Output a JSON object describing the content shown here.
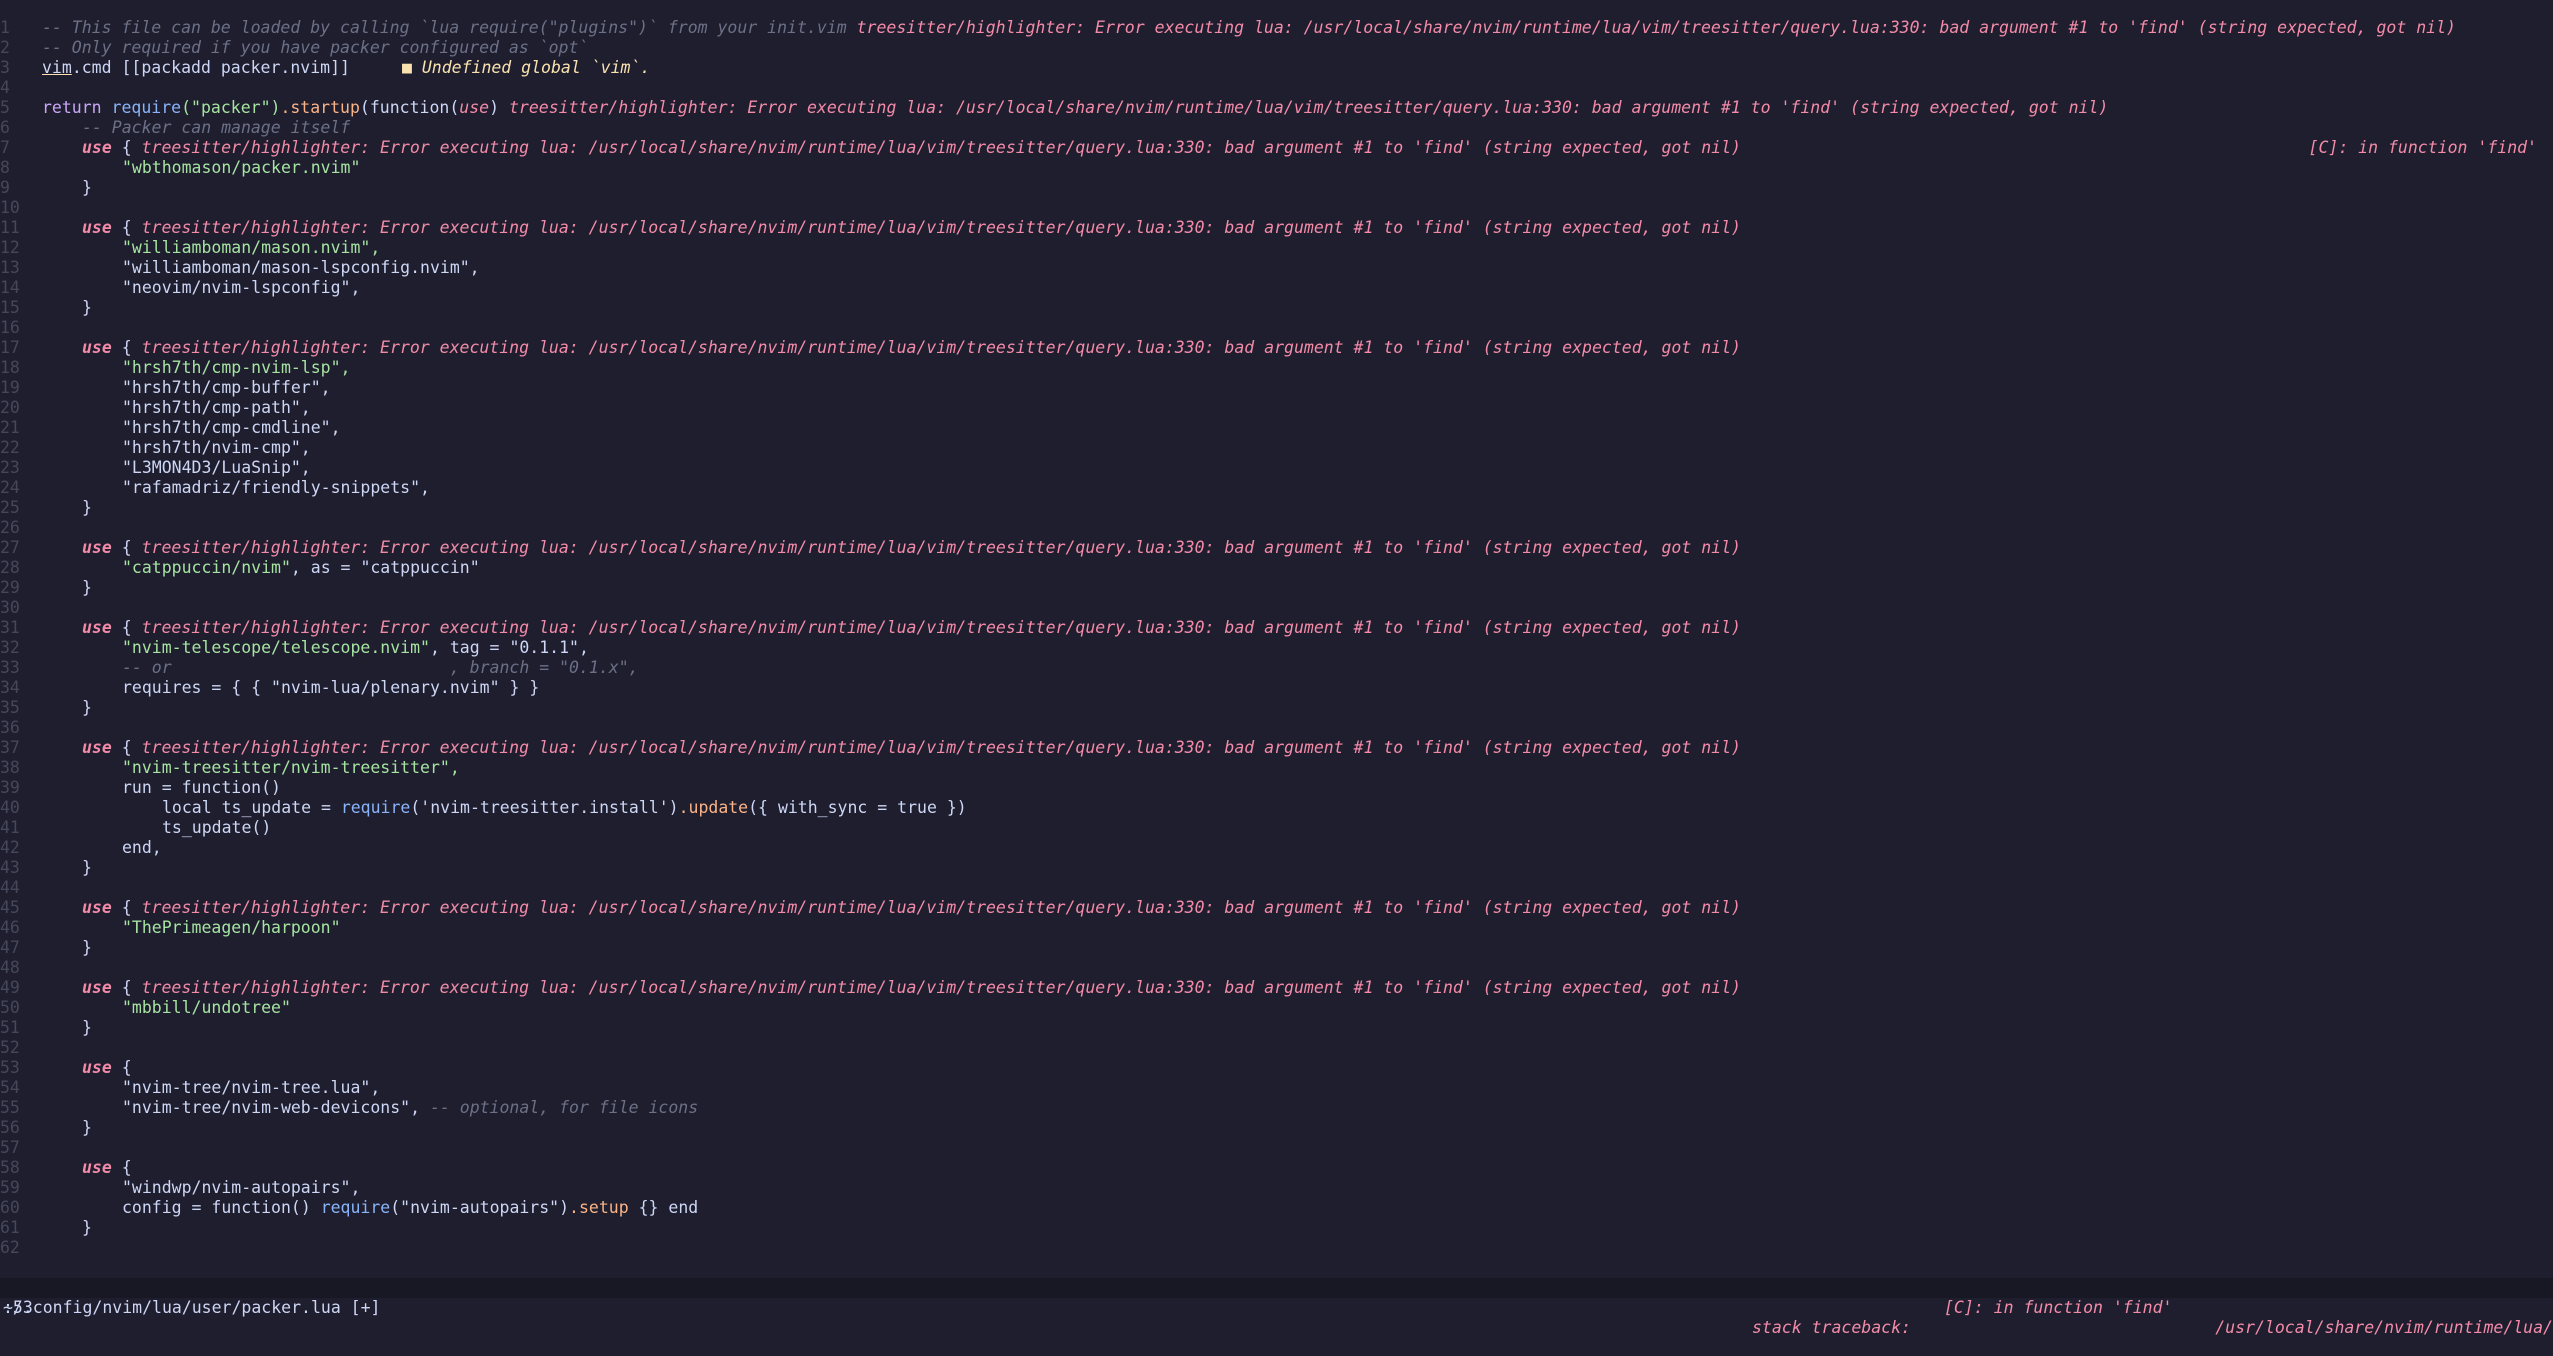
{
  "err": "treesitter/highlighter: Error executing lua: /usr/local/share/nvim/runtime/lua/vim/treesitter/query.lua:330: bad argument #1 to 'find' (string expected, got nil)",
  "right_err": "[C]: in function 'find'",
  "line1_comment": "-- This file can be loaded by calling `lua require(\"plugins\")` from your init.vim",
  "line2_comment": "-- Only required if you have packer configured as `opt`",
  "line3": {
    "vim": "vim",
    "rest": ".cmd [[packadd packer.nvim]]",
    "diag": "■ Undefined global `vim`."
  },
  "line5": {
    "return": "return",
    "require": "require",
    "arg": "(\"packer\")",
    "startup": ".startup",
    "func": "(function(",
    "use": "use",
    "close": ")"
  },
  "line6_comment": "-- Packer can manage itself",
  "use_open": "use {",
  "use_kw": "use",
  "brace_open": " {",
  "brace_close": "}",
  "plugins": {
    "packer": "\"wbthomason/packer.nvim\"",
    "mason": "\"williamboman/mason.nvim\",",
    "mason_lsp": "\"williamboman/mason-lspconfig.nvim\",",
    "lspconfig": "\"neovim/nvim-lspconfig\",",
    "cmp_lsp": "\"hrsh7th/cmp-nvim-lsp\",",
    "cmp_buffer": "\"hrsh7th/cmp-buffer\",",
    "cmp_path": "\"hrsh7th/cmp-path\",",
    "cmp_cmdline": "\"hrsh7th/cmp-cmdline\",",
    "nvim_cmp": "\"hrsh7th/nvim-cmp\",",
    "luasnip": "\"L3MON4D3/LuaSnip\",",
    "friendly": "\"rafamadriz/friendly-snippets\",",
    "catppuccin": "\"catppuccin/nvim\"",
    "catppuccin_as": ", as = ",
    "catppuccin_name": "\"catppuccin\"",
    "telescope": "\"nvim-telescope/telescope.nvim\"",
    "telescope_tag": ", tag = ",
    "telescope_ver": "\"0.1.1\",",
    "telescope_or": "-- or                            , branch = \"0.1.x\",",
    "requires": "requires",
    "requires_rest": " = { { ",
    "plenary": "\"nvim-lua/plenary.nvim\"",
    "requires_end": " } }",
    "treesitter": "\"nvim-treesitter/nvim-treesitter\",",
    "run": "run",
    "run_rest": " = function()",
    "ts_local": "local ts_update = ",
    "ts_require": "require",
    "ts_arg": "('nvim-treesitter.install')",
    "ts_update": ".update",
    "ts_open": "({ ",
    "ts_with": "with_sync",
    "ts_eq": " = ",
    "ts_true": "true",
    "ts_close": " })",
    "ts_call": "ts_update()",
    "end_comma": "end,",
    "harpoon": "\"ThePrimeagen/harpoon\"",
    "undotree": "\"mbbill/undotree\"",
    "nvimtree": "\"nvim-tree/nvim-tree.lua\",",
    "devicons": "\"nvim-tree/nvim-web-devicons\",",
    "devicons_comment": "-- optional, for file icons",
    "autopairs": "\"windwp/nvim-autopairs\",",
    "config": "config",
    "config_rest": " = function() ",
    "config_require": "require",
    "config_arg": "(\"nvim-autopairs\")",
    "config_setup": ".setup",
    "config_end": " {} end"
  },
  "statusline": {
    "path": "~/.config/nvim/lua/user/packer.lua [+]",
    "trace": "stack traceback:"
  },
  "cmdline": {
    "cmd": ":53",
    "msg1": "[C]: in function 'find'",
    "msg2": "/usr/local/share/nvim/runtime/lua/"
  },
  "line_numbers": [
    "1",
    "2",
    "3",
    "4",
    "5",
    "6",
    "7",
    "8",
    "9",
    "10",
    "11",
    "12",
    "13",
    "14",
    "15",
    "16",
    "17",
    "18",
    "19",
    "20",
    "21",
    "22",
    "23",
    "24",
    "25",
    "26",
    "27",
    "28",
    "29",
    "30",
    "31",
    "32",
    "33",
    "34",
    "35",
    "36",
    "37",
    "38",
    "39",
    "40",
    "41",
    "42",
    "43",
    "44",
    "45",
    "46",
    "47",
    "48",
    "49",
    "50",
    "51",
    "52",
    "53",
    "54",
    "55",
    "56",
    "57",
    "58",
    "59",
    "60",
    "61",
    "62"
  ],
  "colors": {
    "background": "#1e1e2e",
    "error": "#f38ba8",
    "string": "#a6e3a1",
    "comment": "#6c7086",
    "keyword": "#cba6f7",
    "function": "#89b4fa",
    "method": "#fab387",
    "warning": "#f9e2af"
  }
}
